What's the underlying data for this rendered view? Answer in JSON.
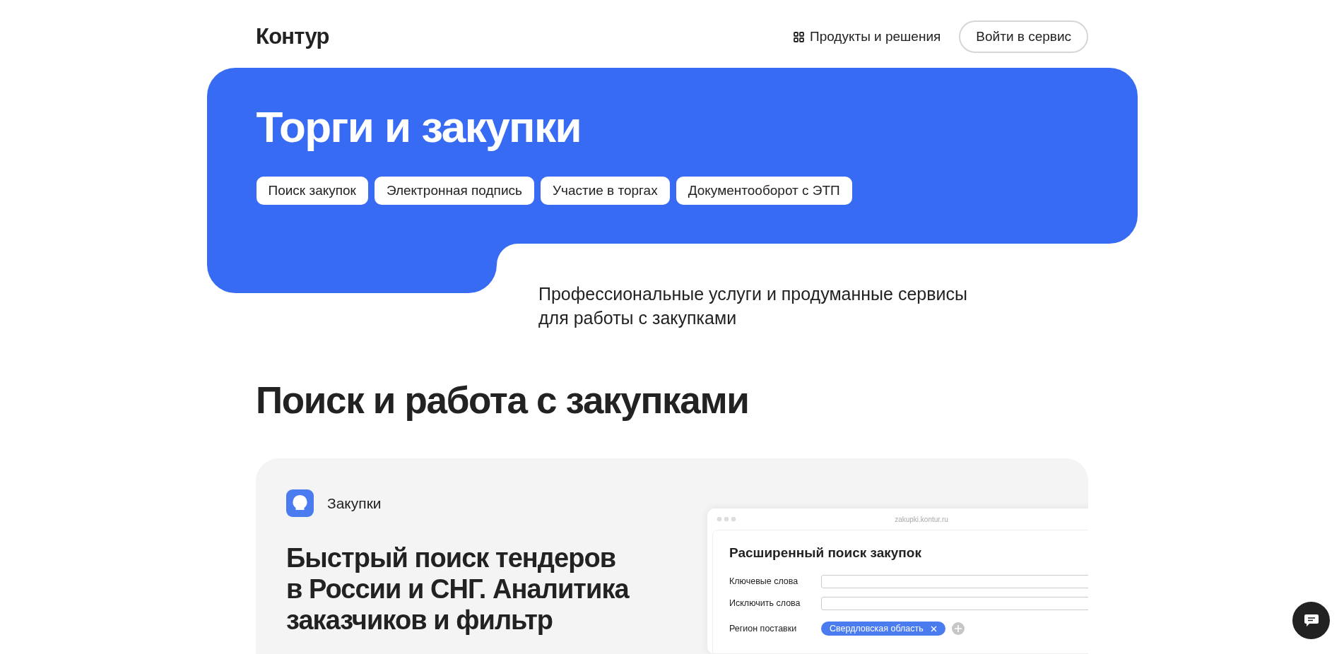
{
  "header": {
    "logo": "Контур",
    "nav_link": "Продукты и решения",
    "login_button": "Войти в сервис"
  },
  "hero": {
    "title": "Торги и закупки",
    "tabs": [
      {
        "label": "Поиск закупок"
      },
      {
        "label": "Электронная подпись"
      },
      {
        "label": "Участие в торгах"
      },
      {
        "label": "Документооборот с ЭТП"
      }
    ],
    "subtitle": [
      "Профессиональные услуги и продуманные сервисы",
      "для работы с закупками"
    ]
  },
  "section": {
    "title": "Поиск и работа с закупками",
    "card": {
      "product": "Закупки",
      "heading": [
        "Быстрый поиск тендеров",
        "в России и СНГ. Аналитика",
        "заказчиков и фильтр"
      ],
      "preview": {
        "url": "zakupki.kontur.ru",
        "title": "Расширенный поиск закупок",
        "rows": [
          {
            "kind": "input",
            "label": "Ключевые слова"
          },
          {
            "kind": "input",
            "label": "Исключить слова"
          },
          {
            "kind": "tags",
            "label": "Регион поставки",
            "tags": [
              "Свердловская область"
            ]
          }
        ]
      }
    }
  }
}
